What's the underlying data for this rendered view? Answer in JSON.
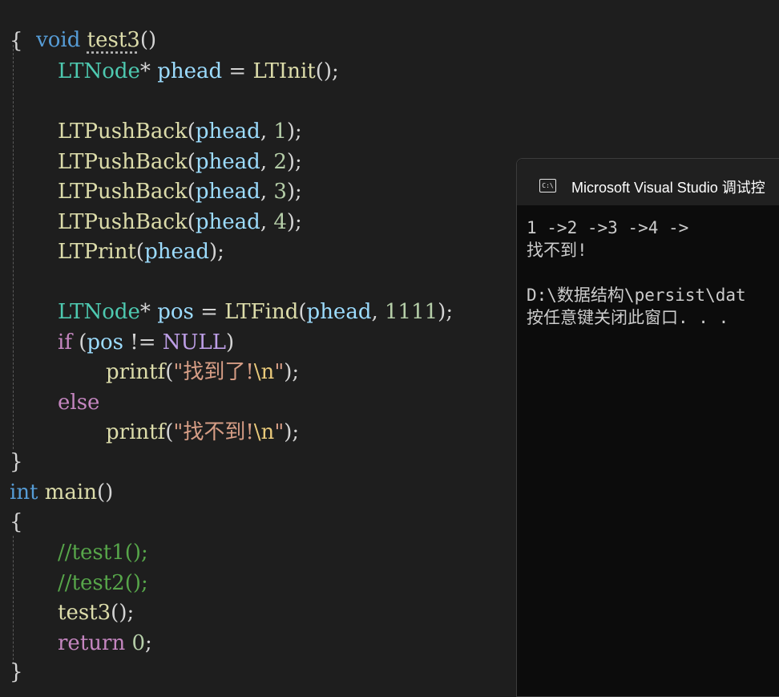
{
  "editor": {
    "test3_signature": {
      "ret": "void",
      "name": "test3",
      "parens": "()"
    },
    "open_brace": "{",
    "close_brace": "}",
    "l_init": {
      "type": "LTNode",
      "star": "*",
      "var": "phead",
      "eq": "=",
      "fn": "LTInit",
      "tail": "();"
    },
    "push_calls": [
      {
        "fn": "LTPushBack",
        "open": "(",
        "var": "phead",
        "sep": ", ",
        "num": "1",
        "close": ");"
      },
      {
        "fn": "LTPushBack",
        "open": "(",
        "var": "phead",
        "sep": ", ",
        "num": "2",
        "close": ");"
      },
      {
        "fn": "LTPushBack",
        "open": "(",
        "var": "phead",
        "sep": ", ",
        "num": "3",
        "close": ");"
      },
      {
        "fn": "LTPushBack",
        "open": "(",
        "var": "phead",
        "sep": ", ",
        "num": "4",
        "close": ");"
      }
    ],
    "l_print": {
      "fn": "LTPrint",
      "open": "(",
      "var": "phead",
      "close": ");"
    },
    "l_find": {
      "type": "LTNode",
      "star": "*",
      "var": "pos",
      "eq": "=",
      "fn": "LTFind",
      "open": "(",
      "arg": "phead",
      "sep": ", ",
      "num": "1111",
      "close": ");"
    },
    "l_if": {
      "kw": "if",
      "open": "(",
      "var": "pos",
      "op": "!=",
      "macro": "NULL",
      "close": ")"
    },
    "l_printf_found": {
      "fn": "printf",
      "open": "(",
      "str": "\"找到了!",
      "esc": "\\n",
      "strend": "\"",
      "close": ");"
    },
    "l_else": "else",
    "l_printf_notfound": {
      "fn": "printf",
      "open": "(",
      "str": "\"找不到!",
      "esc": "\\n",
      "strend": "\"",
      "close": ");"
    },
    "main_signature": {
      "ret": "int",
      "name": "main",
      "parens": "()"
    },
    "main_comments": [
      "//test1();",
      "//test2();"
    ],
    "l_call_test3": {
      "fn": "test3",
      "tail": "();"
    },
    "l_return": {
      "kw": "return",
      "num": "0",
      "tail": ";"
    }
  },
  "console": {
    "title": "Microsoft Visual Studio 调试控",
    "icon": "console-app-icon",
    "icon_text": "C:\\",
    "lines": [
      "1 ->2 ->3 ->4 ->",
      "找不到!",
      "",
      "D:\\数据结构\\persist\\dat",
      "按任意键关闭此窗口. . ."
    ]
  }
}
